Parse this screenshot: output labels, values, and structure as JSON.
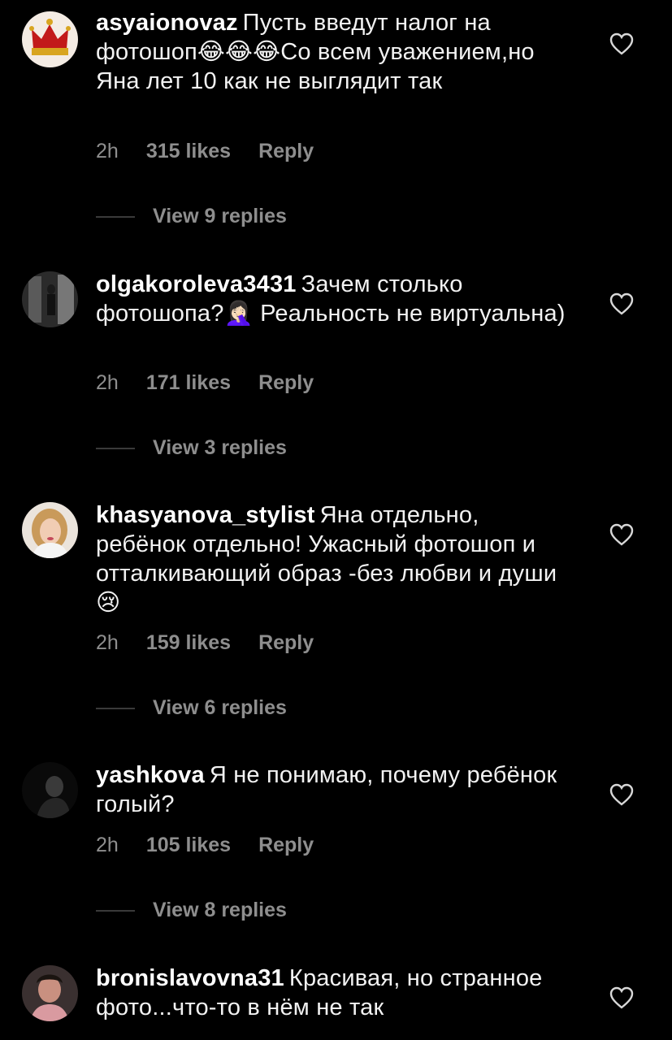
{
  "comments": [
    {
      "username": "asyaionovaz",
      "text": "Пусть введут налог на фотошоп😂😂😂Со всем уважением,но Яна лет 10 как не выглядит так",
      "time": "2h",
      "likes": "315 likes",
      "reply": "Reply",
      "view_replies": "View 9 replies"
    },
    {
      "username": "olgakoroleva3431",
      "text": "Зачем столько фотошопа?🤦🏻‍♀️  Реальность не виртуальна)",
      "time": "2h",
      "likes": "171 likes",
      "reply": "Reply",
      "view_replies": "View 3 replies"
    },
    {
      "username": "khasyanova_stylist",
      "text": "Яна отдельно, ребёнок отдельно! Ужасный фотошоп и  отталкивающий образ -без любви и души😢",
      "time": "2h",
      "likes": "159 likes",
      "reply": "Reply",
      "view_replies": "View 6 replies"
    },
    {
      "username": "yashkova",
      "text": "Я не понимаю, почему ребёнок голый?",
      "time": "2h",
      "likes": "105 likes",
      "reply": "Reply",
      "view_replies": "View 8 replies"
    },
    {
      "username": "bronislavovna31",
      "text": "Красивая, но странное фото...что-то в нём не так"
    }
  ],
  "icons": {
    "like": "heart-outline-icon"
  },
  "colors": {
    "background": "#000000",
    "text": "#f2f2f2",
    "muted": "#8e8e8e"
  }
}
